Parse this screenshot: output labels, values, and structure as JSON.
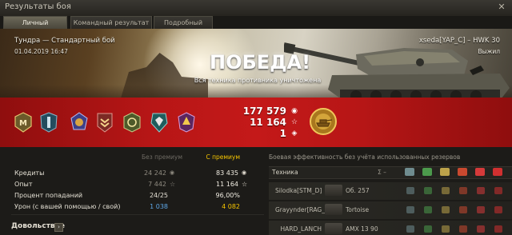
{
  "window": {
    "title": "Результаты боя",
    "close_glyph": "✕"
  },
  "tabs": [
    {
      "label": "Личный результат",
      "active": true
    },
    {
      "label": "Командный результат",
      "active": false
    },
    {
      "label": "Подробный отчёт",
      "active": false
    }
  ],
  "banner": {
    "map_mode": "Тундра — Стандартный бой",
    "datetime": "01.04.2019 16:47",
    "player_tank": "xseda[YAP_C] – HWK 30",
    "status": "Выжил",
    "result": "ПОБЕДА!",
    "result_subtitle": "Вся техника противника уничтожена"
  },
  "totals": {
    "credits": "177 579",
    "xp": "11 164",
    "free_xp": "1",
    "credits_icon": "credits-coin-icon",
    "xp_icon": "star-icon"
  },
  "badges": [
    {
      "name": "mastery-badge-icon",
      "letter": "М",
      "color": "#c9a64a"
    },
    {
      "name": "achievement-1-icon",
      "color": "#2f6f88"
    },
    {
      "name": "achievement-2-icon",
      "color": "#6a6ec2"
    },
    {
      "name": "achievement-3-icon",
      "color": "#b33a2f"
    },
    {
      "name": "achievement-4-icon",
      "color": "#7c7b35"
    },
    {
      "name": "achievement-5-icon",
      "color": "#2c8a8a"
    },
    {
      "name": "achievement-6-icon",
      "color": "#9a3aa0"
    },
    {
      "name": "achievement-7-icon",
      "color": "#3a7ad1"
    }
  ],
  "stats": {
    "col_nonpremium": "Без премиум",
    "col_premium": "С премиум",
    "rows": [
      {
        "label": "Кредиты",
        "nonprem": "24 242",
        "prem": "83 435",
        "icon": "credits-coin-icon"
      },
      {
        "label": "Опыт",
        "nonprem": "7 442",
        "prem": "11 164",
        "icon": "star-icon"
      },
      {
        "label": "Процент попаданий",
        "nonprem": "24/25",
        "prem": "96,00%",
        "icon": ""
      },
      {
        "label": "Урон (с вашей помощью / свой)",
        "nonprem": "1 038",
        "prem": "4 082",
        "icon": ""
      }
    ],
    "comfort_label": "Довольствие",
    "comfort_btn": "›"
  },
  "efficiency": {
    "title": "Боевая эффективность без учёта использованных резервов",
    "header_label": "Техника",
    "header_sum": "Σ –",
    "players": [
      {
        "name": "Silodka[STM_D]",
        "tank": "Об. 257"
      },
      {
        "name": "Grayynder[RAG_D]",
        "tank": "Tortoise"
      },
      {
        "name": "HARD_LANCH",
        "tank": "AMX 13 90"
      }
    ]
  },
  "colors": {
    "accent_gold": "#f2c94c",
    "premium_yellow": "#f5c400",
    "damage_blue": "#5ea8e8",
    "banner_red": "#c41919"
  }
}
